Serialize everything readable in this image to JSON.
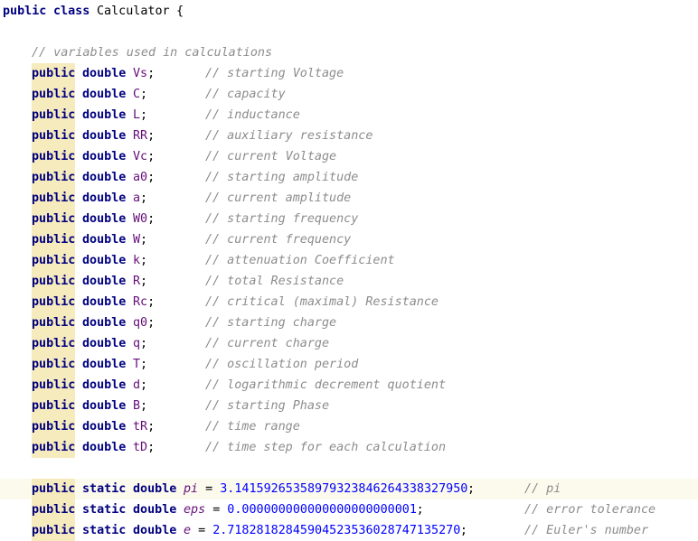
{
  "editor": {
    "class_decl": {
      "kw_public": "public",
      "kw_class": "class",
      "class_name": "Calculator",
      "brace": "{"
    },
    "section_comment": "// variables used in calculations",
    "fields": [
      {
        "mod": "public",
        "type": "double",
        "name": "Vs",
        "semi": ";",
        "comment": "// starting Voltage"
      },
      {
        "mod": "public",
        "type": "double",
        "name": "C",
        "semi": ";",
        "comment": "// capacity"
      },
      {
        "mod": "public",
        "type": "double",
        "name": "L",
        "semi": ";",
        "comment": "// inductance"
      },
      {
        "mod": "public",
        "type": "double",
        "name": "RR",
        "semi": ";",
        "comment": "// auxiliary resistance"
      },
      {
        "mod": "public",
        "type": "double",
        "name": "Vc",
        "semi": ";",
        "comment": "// current Voltage"
      },
      {
        "mod": "public",
        "type": "double",
        "name": "a0",
        "semi": ";",
        "comment": "// starting amplitude"
      },
      {
        "mod": "public",
        "type": "double",
        "name": "a",
        "semi": ";",
        "comment": "// current amplitude"
      },
      {
        "mod": "public",
        "type": "double",
        "name": "W0",
        "semi": ";",
        "comment": "// starting frequency"
      },
      {
        "mod": "public",
        "type": "double",
        "name": "W",
        "semi": ";",
        "comment": "// current frequency"
      },
      {
        "mod": "public",
        "type": "double",
        "name": "k",
        "semi": ";",
        "comment": "// attenuation Coefficient"
      },
      {
        "mod": "public",
        "type": "double",
        "name": "R",
        "semi": ";",
        "comment": "// total Resistance"
      },
      {
        "mod": "public",
        "type": "double",
        "name": "Rc",
        "semi": ";",
        "comment": "// critical (maximal) Resistance"
      },
      {
        "mod": "public",
        "type": "double",
        "name": "q0",
        "semi": ";",
        "comment": "// starting charge"
      },
      {
        "mod": "public",
        "type": "double",
        "name": "q",
        "semi": ";",
        "comment": "// current charge"
      },
      {
        "mod": "public",
        "type": "double",
        "name": "T",
        "semi": ";",
        "comment": "// oscillation period"
      },
      {
        "mod": "public",
        "type": "double",
        "name": "d",
        "semi": ";",
        "comment": "// logarithmic decrement quotient"
      },
      {
        "mod": "public",
        "type": "double",
        "name": "B",
        "semi": ";",
        "comment": "// starting Phase"
      },
      {
        "mod": "public",
        "type": "double",
        "name": "tR",
        "semi": ";",
        "comment": "// time range"
      },
      {
        "mod": "public",
        "type": "double",
        "name": "tD",
        "semi": ";",
        "comment": "// time step for each calculation"
      }
    ],
    "constants": [
      {
        "mod": "public",
        "static": "static",
        "type": "double",
        "name": "pi",
        "eq": "=",
        "value": "3.14159265358979323846264338327950",
        "semi": ";",
        "comment": "// pi"
      },
      {
        "mod": "public",
        "static": "static",
        "type": "double",
        "name": "eps",
        "eq": "=",
        "value": "0.000000000000000000000001",
        "semi": ";",
        "comment": "// error tolerance"
      },
      {
        "mod": "public",
        "static": "static",
        "type": "double",
        "name": "e",
        "eq": "=",
        "value": "2.71828182845904523536028747135270",
        "semi": ";",
        "comment": "// Euler's number"
      }
    ]
  }
}
